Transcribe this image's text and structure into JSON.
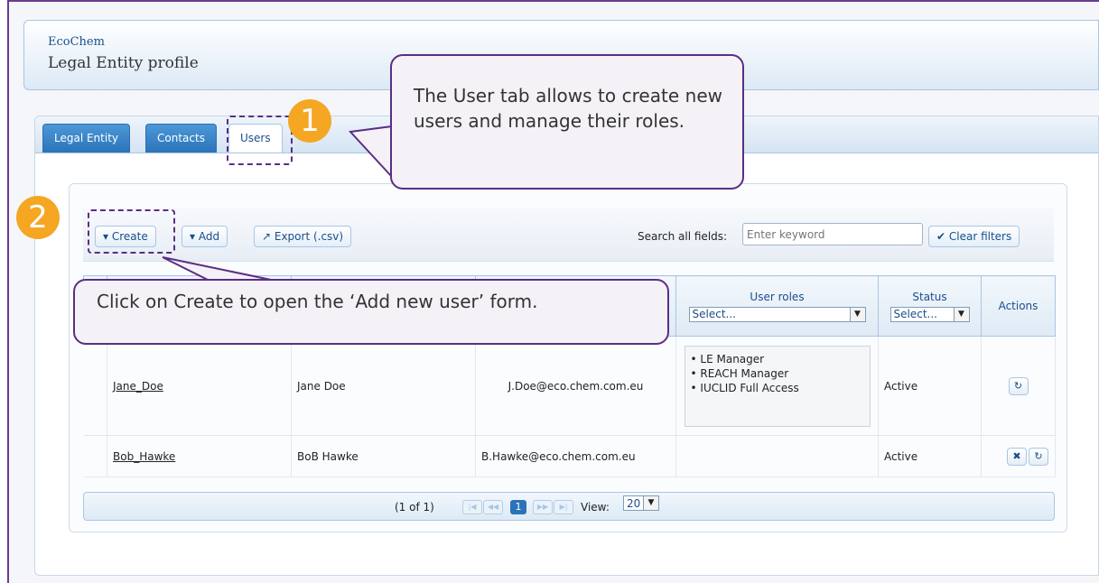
{
  "header": {
    "org": "EcoChem",
    "title": "Legal Entity profile"
  },
  "tabs": [
    {
      "label": "Legal Entity"
    },
    {
      "label": "Contacts"
    },
    {
      "label": "Users"
    }
  ],
  "toolbar": {
    "create_label": "▾ Create",
    "add_label": "▾ Add",
    "export_label": "↗ Export (.csv)",
    "search_label": "Search all fields:",
    "search_placeholder": "Enter keyword",
    "clear_label": "✔ Clear filters"
  },
  "table": {
    "columns": {
      "roles": "User roles",
      "status": "Status",
      "actions": "Actions"
    },
    "roles_filter": "Select...",
    "status_filter": "Select...",
    "rows": [
      {
        "username": "Jane_Doe",
        "name": "Jane Doe",
        "email": "J.Doe@eco.chem.com.eu",
        "roles": [
          "LE Manager",
          "REACH Manager",
          "IUCLID Full Access"
        ],
        "status": "Active"
      },
      {
        "username": "Bob_Hawke",
        "name": "BoB Hawke",
        "email": "B.Hawke@eco.chem.com.eu",
        "roles": [],
        "status": "Active"
      }
    ]
  },
  "pager": {
    "info": "(1 of 1)",
    "current_page": "1",
    "view_label": "View:",
    "page_size": "20"
  },
  "callouts": {
    "step1_number": "1",
    "step1_text": "The User tab allows to create new users and manage their roles.",
    "step2_number": "2",
    "step2_text": "Click on Create to open the ‘Add new user’ form."
  },
  "colors": {
    "accent": "#2b73b9",
    "callout_border": "#5b2d84",
    "step_badge": "#f5a623"
  },
  "icons": [
    "caret-down-icon",
    "export-icon",
    "check-icon",
    "refresh-icon",
    "delete-icon",
    "first-page-icon",
    "prev-page-icon",
    "next-page-icon",
    "last-page-icon"
  ]
}
